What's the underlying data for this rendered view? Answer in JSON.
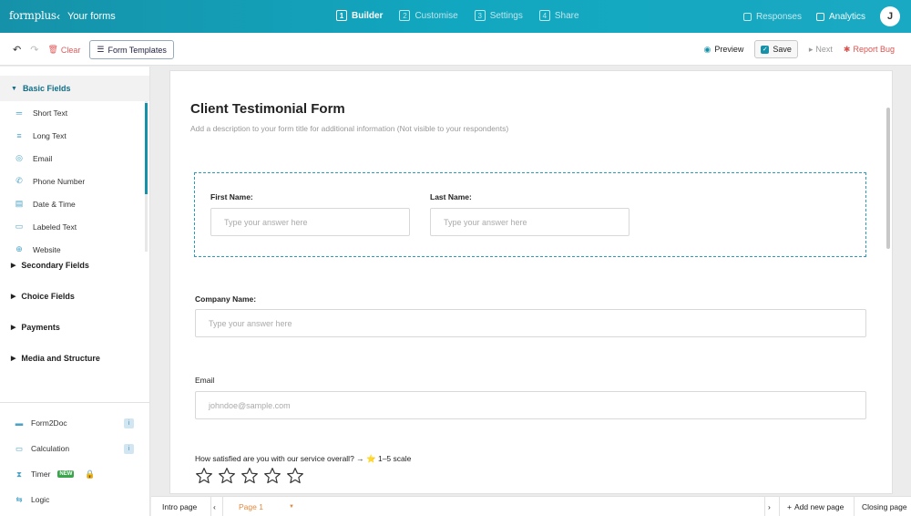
{
  "topbar": {
    "logo": "formplus",
    "back_label": "Your forms",
    "steps": [
      {
        "num": "1",
        "label": "Builder",
        "active": true
      },
      {
        "num": "2",
        "label": "Customise",
        "active": false
      },
      {
        "num": "3",
        "label": "Settings",
        "active": false
      },
      {
        "num": "4",
        "label": "Share",
        "active": false
      }
    ],
    "responses_label": "Responses",
    "analytics_label": "Analytics",
    "avatar_initial": "J"
  },
  "toolbar": {
    "clear_label": "Clear",
    "templates_label": "Form Templates",
    "preview_label": "Preview",
    "save_label": "Save",
    "next_label": "Next",
    "report_label": "Report Bug"
  },
  "sidebar": {
    "basic_fields_label": "Basic Fields",
    "basic_fields": [
      {
        "label": "Short Text",
        "icon": "short-text-icon"
      },
      {
        "label": "Long Text",
        "icon": "long-text-icon"
      },
      {
        "label": "Email",
        "icon": "email-icon"
      },
      {
        "label": "Phone Number",
        "icon": "phone-icon"
      },
      {
        "label": "Date & Time",
        "icon": "calendar-icon"
      },
      {
        "label": "Labeled Text",
        "icon": "labeled-text-icon"
      },
      {
        "label": "Website",
        "icon": "globe-icon"
      }
    ],
    "sections": [
      "Secondary Fields",
      "Choice Fields",
      "Payments",
      "Media and Structure"
    ],
    "bottom": {
      "form2doc": "Form2Doc",
      "calculation": "Calculation",
      "timer": "Timer",
      "timer_badge": "NEW",
      "logic": "Logic"
    }
  },
  "form": {
    "title": "Client Testimonial Form",
    "description": "Add a description to your form title for additional information (Not visible to your respondents)",
    "first_name_label": "First Name:",
    "first_name_placeholder": "Type your answer here",
    "last_name_label": "Last Name:",
    "last_name_placeholder": "Type your answer here",
    "company_label": "Company Name:",
    "company_placeholder": "Type your answer here",
    "email_label": "Email",
    "email_placeholder": "johndoe@sample.com",
    "rating_question": "How satisfied are you with our service overall? → ⭐ 1–5 scale",
    "rating_max": 5,
    "rating_value": 0
  },
  "pages": {
    "intro": "Intro page",
    "current": "Page 1",
    "add_new": "Add new page",
    "closing": "Closing page"
  },
  "colors": {
    "brand": "#1592a9",
    "accent_orange": "#e2883a",
    "danger": "#d9534f"
  }
}
